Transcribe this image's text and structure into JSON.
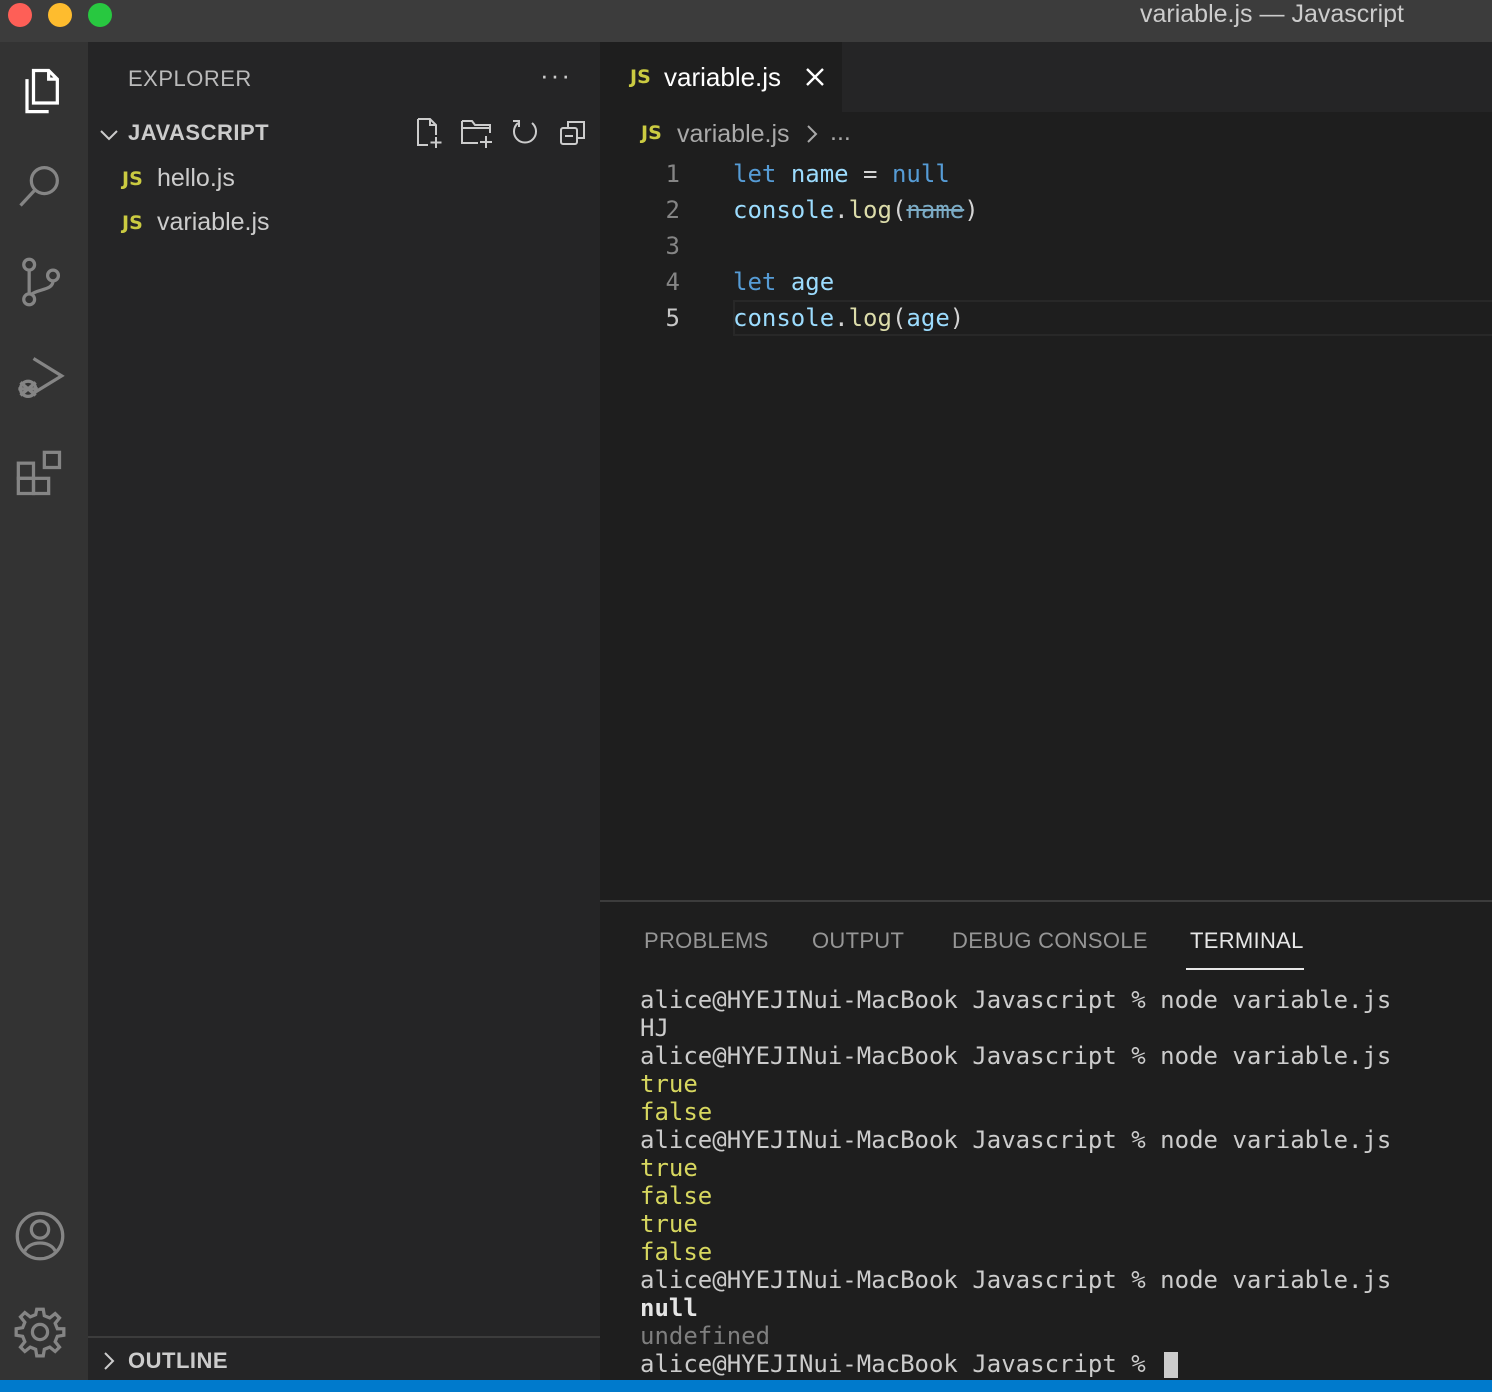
{
  "window": {
    "title": "variable.js — Javascript"
  },
  "activity_bar": {
    "items": [
      "files-icon",
      "search-icon",
      "source-control-icon",
      "run-debug-icon",
      "extensions-icon",
      "account-icon",
      "gear-icon"
    ]
  },
  "explorer": {
    "title": "EXPLORER",
    "more": "···",
    "folder": "JAVASCRIPT",
    "files": [
      {
        "badge": "JS",
        "name": "hello.js"
      },
      {
        "badge": "JS",
        "name": "variable.js"
      }
    ],
    "outline": "OUTLINE"
  },
  "editor": {
    "tab": {
      "badge": "JS",
      "name": "variable.js"
    },
    "breadcrumb": {
      "badge": "JS",
      "file": "variable.js",
      "ellipsis": "..."
    },
    "lines": [
      {
        "num": "1",
        "kw": "let",
        "var": "name",
        "eq": " = ",
        "val": "null"
      },
      {
        "num": "2",
        "obj": "console",
        "dot": ".",
        "fn": "log",
        "open": "(",
        "arg": "name",
        "close": ")"
      },
      {
        "num": "3"
      },
      {
        "num": "4",
        "kw": "let",
        "var": "age"
      },
      {
        "num": "5",
        "obj": "console",
        "dot": ".",
        "fn": "log",
        "open": "(",
        "arg": "age",
        "close": ")"
      }
    ]
  },
  "panel": {
    "tabs": [
      "PROBLEMS",
      "OUTPUT",
      "DEBUG CONSOLE",
      "TERMINAL"
    ],
    "active_tab": "TERMINAL",
    "terminal": [
      "alice@HYEJINui-MacBook Javascript % node variable.js",
      "HJ",
      "alice@HYEJINui-MacBook Javascript % node variable.js",
      "true",
      "false",
      "alice@HYEJINui-MacBook Javascript % node variable.js",
      "true",
      "false",
      "true",
      "false",
      "alice@HYEJINui-MacBook Javascript % node variable.js",
      "null",
      "undefined",
      "alice@HYEJINui-MacBook Javascript % "
    ]
  },
  "colors": {
    "accent": "#007acc",
    "js_badge": "#cbcb41",
    "keyword": "#569cd6",
    "variable": "#9cdcfe",
    "function": "#dcdcaa",
    "terminal_yellow": "#d7d75f"
  }
}
